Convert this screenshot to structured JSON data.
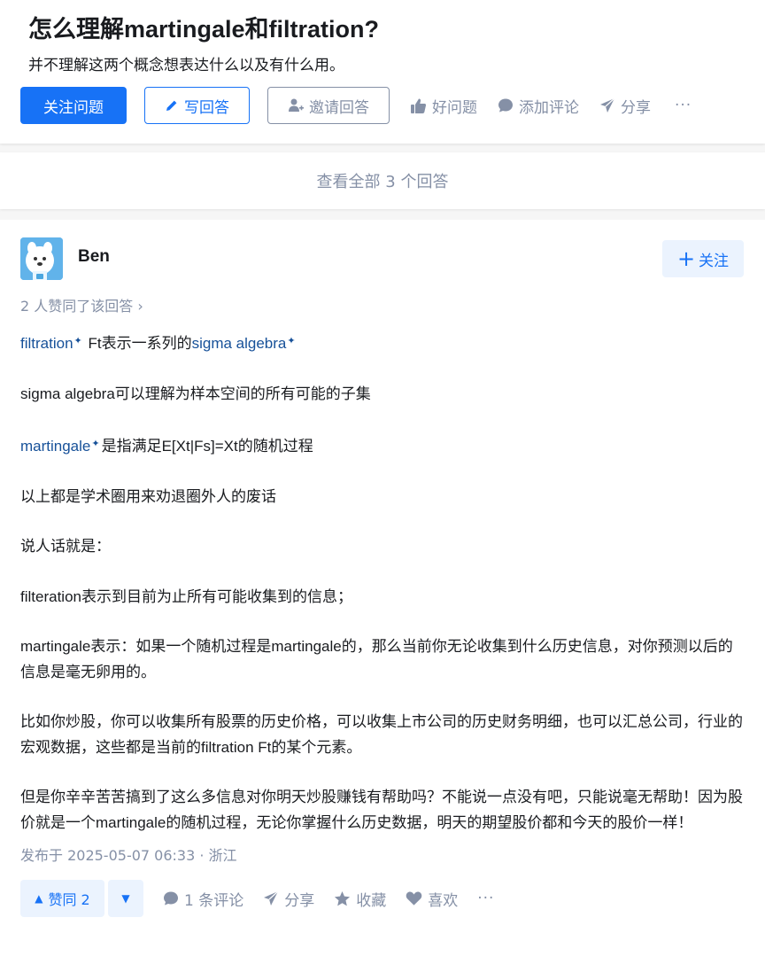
{
  "question": {
    "title": "怎么理解martingale和filtration?",
    "detail": "并不理解这两个概念想表达什么以及有什么用。",
    "actions": {
      "follow": "关注问题",
      "write": "写回答",
      "invite": "邀请回答",
      "good": "好问题",
      "comment": "添加评论",
      "share": "分享",
      "more": "···"
    }
  },
  "view_all": "查看全部 3 个回答",
  "answer": {
    "author": "Ben",
    "follow": "关注",
    "voters": "2 人赞同了该回答 ›",
    "para1": {
      "link1": "filtration",
      "mid": " Ft表示一系列的",
      "link2": "sigma algebra"
    },
    "para2": "sigma algebra可以理解为样本空间的所有可能的子集",
    "para3": {
      "link": "martingale",
      "rest": "是指满足E[Xt|Fs]=Xt的随机过程"
    },
    "para4": "以上都是学术圈用来劝退圈外人的废话",
    "para5": "说人话就是：",
    "para6": "filteration表示到目前为止所有可能收集到的信息；",
    "para7": "martingale表示：如果一个随机过程是martingale的，那么当前你无论收集到什么历史信息，对你预测以后的信息是毫无卵用的。",
    "para8": "比如你炒股，你可以收集所有股票的历史价格，可以收集上市公司的历史财务明细，也可以汇总公司，行业的宏观数据，这些都是当前的filtration Ft的某个元素。",
    "para9": "但是你辛辛苦苦搞到了这么多信息对你明天炒股赚钱有帮助吗？不能说一点没有吧，只能说毫无帮助！因为股价就是一个martingale的随机过程，无论你掌握什么历史数据，明天的期望股价都和今天的股价一样！",
    "time": "发布于 2025-05-07 06:33 · 浙江",
    "bottom": {
      "vote_up": "赞同 2",
      "comments": "1 条评论",
      "share": "分享",
      "collect": "收藏",
      "like": "喜欢",
      "more": "···"
    }
  },
  "colors": {
    "primary": "#1772f6",
    "gray": "#8590a6",
    "link": "#175199"
  }
}
